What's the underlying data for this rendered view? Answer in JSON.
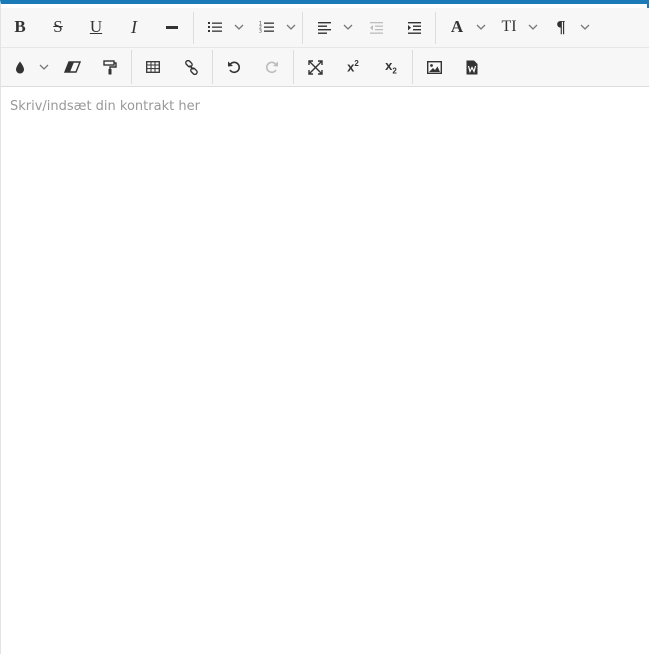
{
  "toolbar": {
    "bold_label": "B",
    "strike_label": "S",
    "underline_label": "U",
    "italic_label": "I",
    "font_color_label": "A",
    "font_size_label": "TI",
    "paragraph_label": "¶",
    "superscript_label": "x",
    "superscript_mark": "2",
    "subscript_label": "x",
    "subscript_mark": "2"
  },
  "icons": {
    "horizontal_rule": "horizontal-rule-icon",
    "bulleted_list": "bulleted-list-icon",
    "numbered_list": "numbered-list-icon",
    "align": "align-left-icon",
    "outdent": "outdent-icon",
    "indent": "indent-icon",
    "background_color": "droplet-icon",
    "clear_format": "eraser-icon",
    "format_painter": "paint-roller-icon",
    "table": "table-icon",
    "link": "link-icon",
    "undo": "undo-icon",
    "redo": "redo-icon",
    "fullscreen": "fullscreen-icon",
    "image": "image-icon",
    "word_import": "word-document-icon"
  },
  "colors": {
    "accent": "#1b7ab8",
    "placeholder": "#999999",
    "disabled": "#bdbdbd"
  },
  "editor": {
    "placeholder": "Skriv/indsæt din kontrakt her"
  }
}
